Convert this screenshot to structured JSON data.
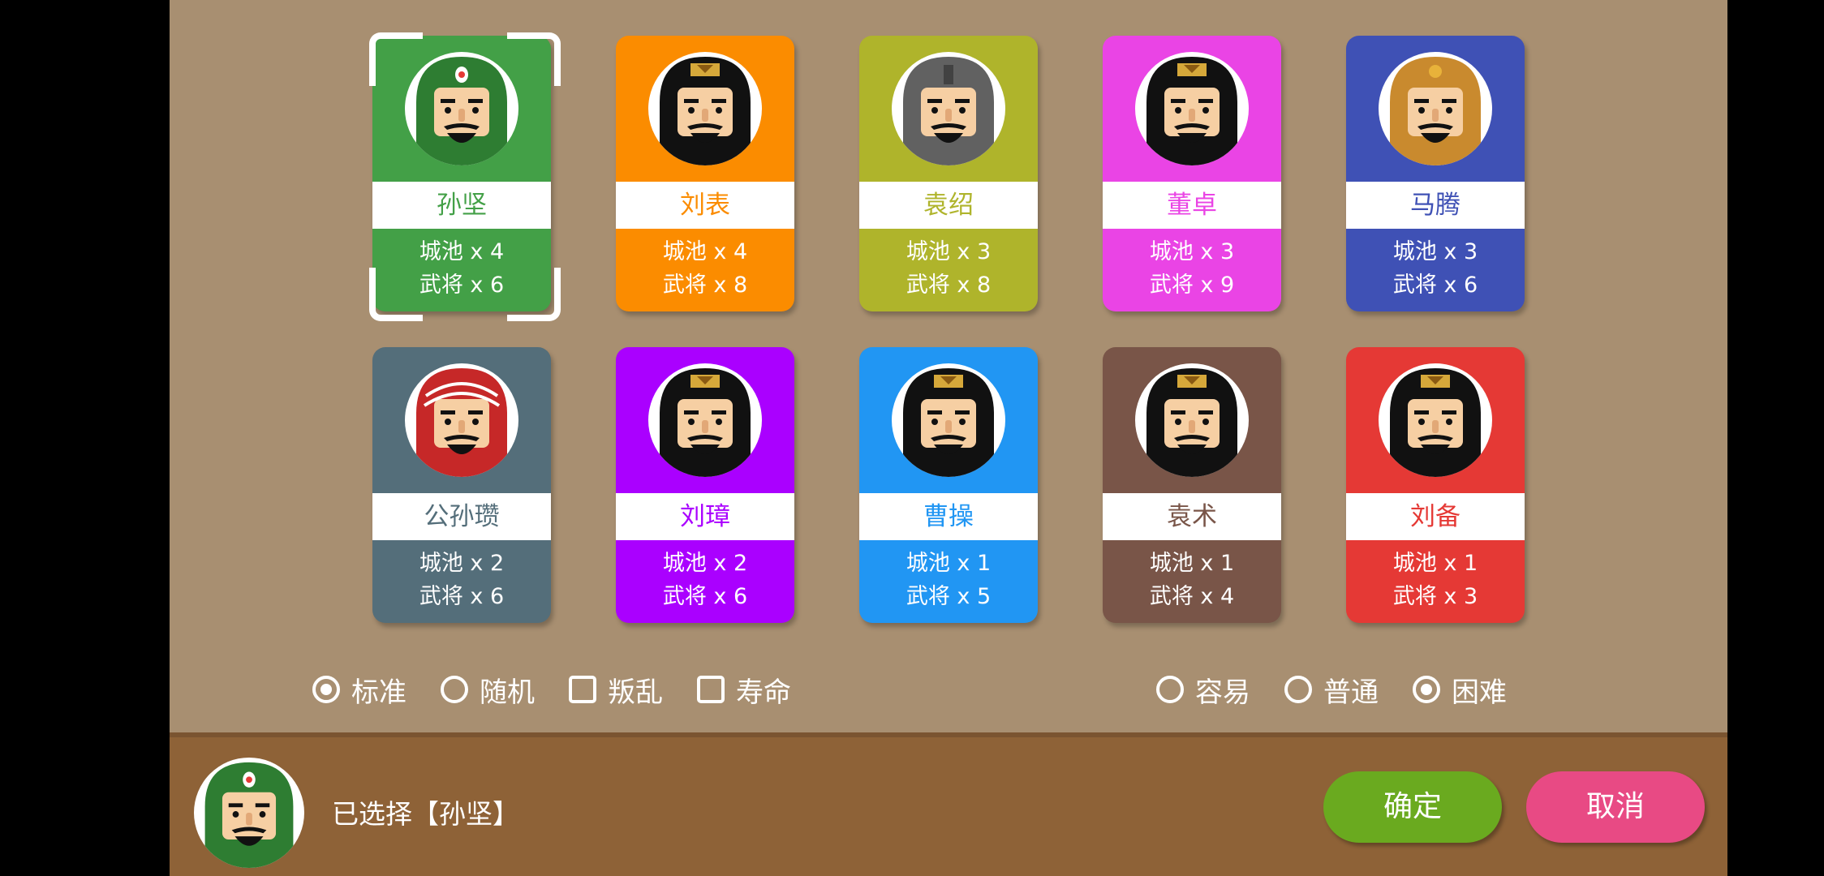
{
  "factions": [
    {
      "name": "孙坚",
      "cities": "城池 x 4",
      "generals": "武将 x 6",
      "color": "#43a047",
      "name_color": "#43a047",
      "helmet": "#2e7d32",
      "hat": "turban-green",
      "selected": true
    },
    {
      "name": "刘表",
      "cities": "城池 x 4",
      "generals": "武将 x 8",
      "color": "#fb8c00",
      "name_color": "#fb8c00",
      "helmet": "#111111",
      "hat": "crown",
      "selected": false
    },
    {
      "name": "袁绍",
      "cities": "城池 x 3",
      "generals": "武将 x 8",
      "color": "#afb42b",
      "name_color": "#afb42b",
      "helmet": "#616161",
      "hat": "helmet",
      "selected": false
    },
    {
      "name": "董卓",
      "cities": "城池 x 3",
      "generals": "武将 x 9",
      "color": "#ea44e5",
      "name_color": "#ea44e5",
      "helmet": "#111111",
      "hat": "crown",
      "selected": false
    },
    {
      "name": "马腾",
      "cities": "城池 x 3",
      "generals": "武将 x 6",
      "color": "#3f51b5",
      "name_color": "#3f51b5",
      "helmet": "#c98a2e",
      "hat": "gold",
      "selected": false
    },
    {
      "name": "公孙瓒",
      "cities": "城池 x 2",
      "generals": "武将 x 6",
      "color": "#546e7a",
      "name_color": "#546e7a",
      "helmet": "#c62828",
      "hat": "turban-red",
      "selected": false
    },
    {
      "name": "刘璋",
      "cities": "城池 x 2",
      "generals": "武将 x 6",
      "color": "#aa00ff",
      "name_color": "#aa00ff",
      "helmet": "#111111",
      "hat": "crown",
      "selected": false
    },
    {
      "name": "曹操",
      "cities": "城池 x 1",
      "generals": "武将 x 5",
      "color": "#2196f3",
      "name_color": "#2196f3",
      "helmet": "#111111",
      "hat": "crown",
      "selected": false
    },
    {
      "name": "袁术",
      "cities": "城池 x 1",
      "generals": "武将 x 4",
      "color": "#795548",
      "name_color": "#795548",
      "helmet": "#111111",
      "hat": "crown",
      "selected": false
    },
    {
      "name": "刘备",
      "cities": "城池 x 1",
      "generals": "武将 x 3",
      "color": "#e53935",
      "name_color": "#e53935",
      "helmet": "#111111",
      "hat": "crown",
      "selected": false
    }
  ],
  "modes": [
    {
      "label": "标准",
      "kind": "radio",
      "checked": true
    },
    {
      "label": "随机",
      "kind": "radio",
      "checked": false
    },
    {
      "label": "叛乱",
      "kind": "check",
      "checked": false
    },
    {
      "label": "寿命",
      "kind": "check",
      "checked": false
    }
  ],
  "difficulty": [
    {
      "label": "容易",
      "checked": false
    },
    {
      "label": "普通",
      "checked": false
    },
    {
      "label": "困难",
      "checked": true
    }
  ],
  "footer": {
    "selected_text": "已选择【孙坚】",
    "confirm_label": "确定",
    "cancel_label": "取消",
    "confirm_color": "#6aaa1f",
    "cancel_color": "#e84a84"
  }
}
